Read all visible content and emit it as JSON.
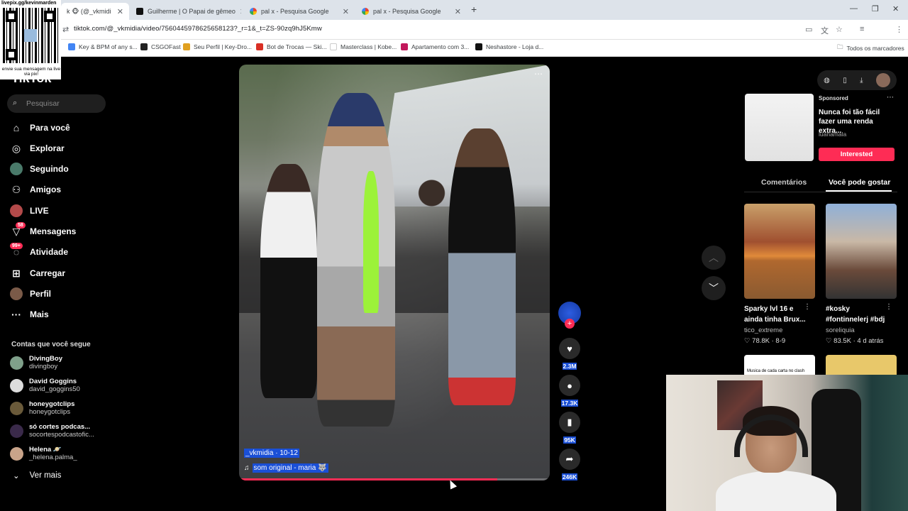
{
  "browser": {
    "tabs": [
      {
        "title": "k 🐵 (@_vkmidi",
        "active": true
      },
      {
        "title": "Guilherme | O Papai de gêmeo"
      },
      {
        "title": "pal x - Pesquisa Google"
      },
      {
        "title": "pal x - Pesquisa Google"
      }
    ],
    "url": "tiktok.com/@_vkmidia/video/7560445978625658123?_r=1&_t=ZS-90zq9hJ5Kmw",
    "bookmarks": [
      "Key & BPM of any s...",
      "CSGOFast",
      "Seu Perfil | Key-Dro...",
      "Bot de Trocas — Ski...",
      "Masterclass | Kobe...",
      "Apartamento com 3...",
      "Neshastore - Loja d..."
    ],
    "bookmarks_right": "Todos os marcadores"
  },
  "overlay": {
    "qr_title": "livepix.gg/kevinmarden",
    "qr_message": "envie sua mensagem na live via pix!"
  },
  "sidebar": {
    "logo": "TikTok",
    "search_placeholder": "Pesquisar",
    "nav": [
      {
        "label": "Para você",
        "icon": "home-icon"
      },
      {
        "label": "Explorar",
        "icon": "compass-icon"
      },
      {
        "label": "Seguindo",
        "icon": "following-icon"
      },
      {
        "label": "Amigos",
        "icon": "friends-icon"
      },
      {
        "label": "LIVE",
        "icon": "live-icon"
      },
      {
        "label": "Mensagens",
        "icon": "message-icon",
        "badge": "58"
      },
      {
        "label": "Atividade",
        "icon": "activity-icon",
        "badge": "99+"
      },
      {
        "label": "Carregar",
        "icon": "upload-icon"
      },
      {
        "label": "Perfil",
        "icon": "profile-icon"
      },
      {
        "label": "Mais",
        "icon": "more-icon"
      }
    ],
    "following_title": "Contas que você segue",
    "accounts": [
      {
        "name": "DivingBoy",
        "handle": "divingboy"
      },
      {
        "name": "David Goggins",
        "handle": "david_goggins50"
      },
      {
        "name": "honeygotclips",
        "handle": "honeygotclips"
      },
      {
        "name": "só cortes podcas...",
        "handle": "socortespodcastofic..."
      },
      {
        "name": "Helena 🪐",
        "handle": "_helena.palma_"
      }
    ],
    "see_more": "Ver mais"
  },
  "video": {
    "author_date": "_vkmidia · 10-12",
    "sound": "som original - maria 🐺",
    "progress": 0.83
  },
  "actions": {
    "likes": "2.3M",
    "comments": "17.3K",
    "saves": "95K",
    "shares": "246K"
  },
  "right_panel": {
    "ad": {
      "label": "Sponsored",
      "title": "Nunca foi tão fácil fazer uma renda extra...",
      "brand": "luanamala",
      "button": "Interested"
    },
    "tabs": [
      "Comentários",
      "Você pode gostar"
    ],
    "cards": [
      {
        "title": "Sparky lvl 16 e ainda tinha Brux...",
        "user": "tico_extreme",
        "stats": "♡ 78.8K · 8-9"
      },
      {
        "title": "#kosky #fontinnelerj #bdj",
        "user": "soreliquia",
        "stats": "♡ 83.5K · 4 d atrás"
      }
    ],
    "next_card_caption": "Musica de cada carta no clash"
  },
  "colors": {
    "accent": "#fe2c55",
    "highlight": "#1a4fd6"
  }
}
